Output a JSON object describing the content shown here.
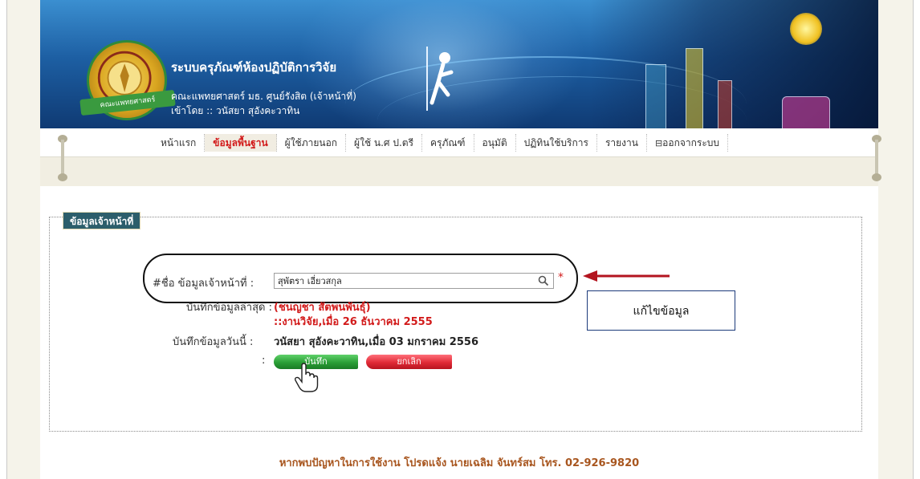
{
  "header": {
    "title": "ระบบครุภัณฑ์ห้องปฏิบัติการวิจัย",
    "faculty": "คณะแพทยศาสตร์ มธ. ศูนย์รังสิต (เจ้าหน้าที่)",
    "logged_in": "เข้าโดย :: วนัสยา สุอังคะวาทิน",
    "logo_ribbon": "คณะแพทยศาสตร์"
  },
  "nav": {
    "items": [
      {
        "label": "หน้าแรก"
      },
      {
        "label": "ข้อมูลพื้นฐาน",
        "active": true
      },
      {
        "label": "ผู้ใช้ภายนอก"
      },
      {
        "label": "ผู้ใช้ น.ศ ป.ตรี"
      },
      {
        "label": "ครุภัณฑ์"
      },
      {
        "label": "อนุมัติ"
      },
      {
        "label": "ปฏิทินใช้บริการ"
      },
      {
        "label": "รายงาน"
      },
      {
        "label": "ออกจากระบบ"
      }
    ]
  },
  "form": {
    "legend": "ข้อมูลเจ้าหน้าที่",
    "staff_label": "#ชื่อ ข้อมูลเจ้าหน้าที่ :",
    "staff_value": "สุพัตรา เอี่ยวสกุล",
    "last_record_label": "บันทึกข้อมูลล่าสุด :",
    "last_record_name": "(ชนญชา สัตพนพันธุ์)",
    "last_record_detail": "::งานวิจัย,เมื่อ 26 ธันวาคม 2555",
    "today_label": "บันทึกข้อมูลวันนี้ :",
    "today_value": "วนัสยา สุอังคะวาทิน,เมื่อ 03 มกราคม 2556",
    "buttons_colon": ":",
    "save_label": "บันทึก",
    "cancel_label": "ยกเลิก",
    "required_mark": "*"
  },
  "annotation": {
    "callout": "แก้ไขข้อมูล"
  },
  "footer": {
    "text": "หากพบปัญหาในการใช้งาน โปรดแจ้ง นายเฉลิม จันทร์สม โทร. 02-926-9820"
  },
  "colors": {
    "accent_red": "#d21b1b",
    "save_green": "#2a9e36",
    "cancel_red": "#e02a36",
    "legend_bg": "#2c5e6b",
    "footer_brown": "#a8561f"
  }
}
